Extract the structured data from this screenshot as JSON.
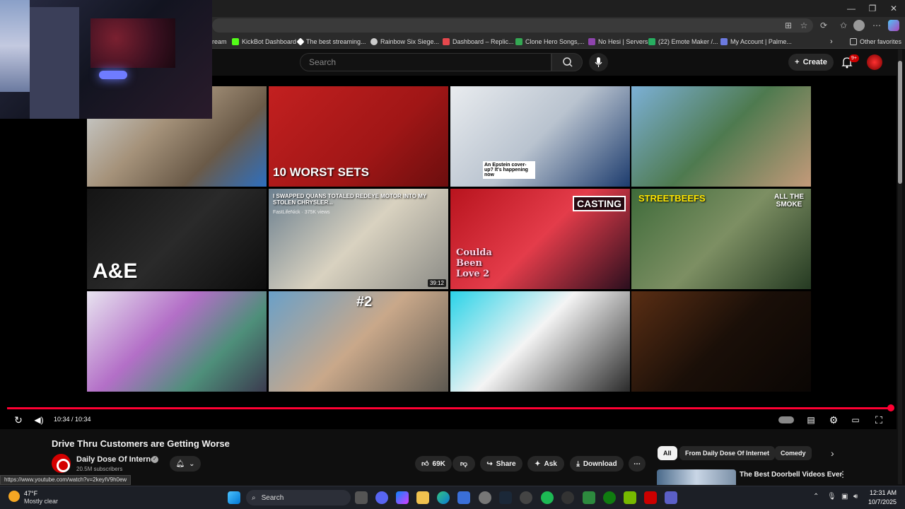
{
  "browser": {
    "window_controls": {
      "minimize": "—",
      "restore": "❐",
      "close": "✕"
    },
    "bookmarks": [
      {
        "label": "ream",
        "color": "#2b2b2b"
      },
      {
        "label": "KickBot Dashboard",
        "color": "#53fc18"
      },
      {
        "label": "The best streaming...",
        "color": "#ffffff"
      },
      {
        "label": "Rainbow Six Siege...",
        "color": "#cccccc"
      },
      {
        "label": "Dashboard – Replic...",
        "color": "#e5484d"
      },
      {
        "label": "Clone Hero Songs,...",
        "color": "#34a853"
      },
      {
        "label": "No Hesi | Servers",
        "color": "#8e44ad"
      },
      {
        "label": "(22) Emote Maker /...",
        "color": "#27ae60"
      },
      {
        "label": "My Account | Palme...",
        "color": "#6c7ae0"
      }
    ],
    "other_favorites": "Other favorites",
    "status_url": "https://www.youtube.com/watch?v=2keyIV9h0ew"
  },
  "youtube": {
    "search_placeholder": "Search",
    "create_label": "Create",
    "notifications_badge": "9+"
  },
  "end_screen": {
    "tiles": [
      {
        "overlay": "",
        "duration": "",
        "bg": "linear-gradient(135deg,#cfd6da 0%,#a5927a 40%,#6a5a48 70%,#2e6fbf 100%)"
      },
      {
        "overlay": "10 WORST SETS",
        "duration": "",
        "bg": "linear-gradient(135deg,#c32020 0%,#a01616 60%,#6b0e0e 100%)"
      },
      {
        "overlay": "An Epstein cover-up? It's happening now",
        "duration": "",
        "bg": "linear-gradient(135deg,#e9ecef 0%,#b9c3cf 50%,#1d3c6e 100%)"
      },
      {
        "overlay": "",
        "duration": "",
        "bg": "linear-gradient(135deg,#7cb0d6 0%,#4e7a4f 50%,#c49a7a 100%)"
      },
      {
        "overlay": "A&E",
        "duration": "",
        "bg": "linear-gradient(135deg,#141414 0%,#2a2a2a 50%,#0c0c0c 100%)"
      },
      {
        "overlay": "I SWAPPED QUANS TOTALED REDEYE MOTOR INTO MY STOLEN CHRYSLER...",
        "sub": "FastLifeNick · 375K views",
        "duration": "39:12",
        "bg": "linear-gradient(135deg,#6b7f8f 0%,#d9d2c0 50%,#8b8b86 100%)"
      },
      {
        "overlay": "CASTING",
        "overlay2": "Coulda Been Love 2",
        "duration": "",
        "bg": "linear-gradient(135deg,#b8141e 0%,#e43c4a 50%,#2b0f1e 100%)"
      },
      {
        "overlay": "STREETBEEFS",
        "overlay2": "ALL THE SMOKE",
        "duration": "",
        "bg": "linear-gradient(135deg,#3e6b3a 0%,#7d8f63 50%,#253a22 100%)"
      },
      {
        "overlay": "",
        "duration": "",
        "bg": "linear-gradient(135deg,#e8e4f0 0%,#b36fc7 40%,#4e8f7a 70%,#3b3b4f 100%)"
      },
      {
        "overlay": "#2",
        "duration": "",
        "bg": "linear-gradient(135deg,#6aa0c8 0%,#c9a88a 50%,#5c5850 100%)"
      },
      {
        "overlay": "",
        "duration": "",
        "bg": "linear-gradient(135deg,#2ad3e8 0%,#f4f4f4 45%,#2a2a2a 100%)"
      },
      {
        "overlay": "",
        "duration": "",
        "bg": "linear-gradient(135deg,#5a2e14 0%,#1a0f08 50%,#0a0604 100%)"
      }
    ]
  },
  "player": {
    "time": "10:34 / 10:34",
    "progress_fraction": 1.0
  },
  "video": {
    "title": "Drive Thru Customers are Getting Worse",
    "channel": "Daily Dose Of Internet",
    "subscribers": "20.5M subscribers",
    "likes": "69K",
    "share": "Share",
    "ask": "Ask",
    "download": "Download"
  },
  "recommendations": {
    "chips": [
      "All",
      "From Daily Dose Of Internet",
      "Comedy"
    ],
    "first_title": "The Best Doorbell Videos Ever"
  },
  "taskbar": {
    "temp": "47°F",
    "weather": "Mostly clear",
    "search": "Search",
    "time": "12:31 AM",
    "date": "10/7/2025"
  }
}
